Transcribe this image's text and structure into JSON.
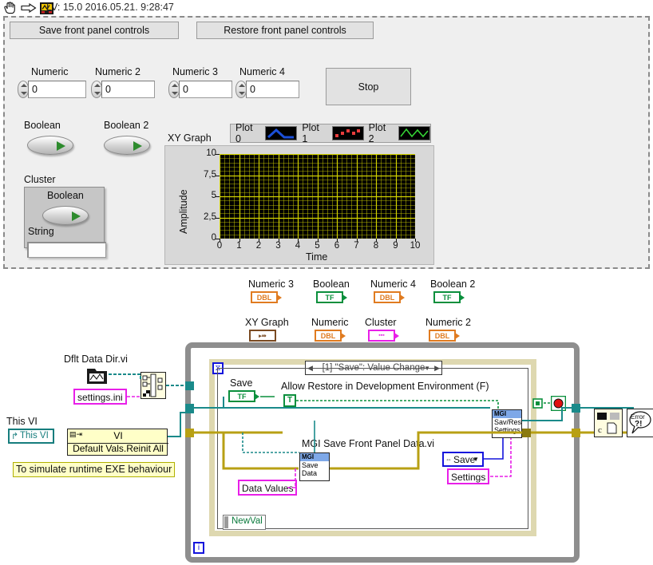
{
  "titlebar": {
    "text": "LV: 15.0 2016.05.21. 9:28:47",
    "icons": [
      "hand-cursor-icon",
      "run-arrow-icon",
      "labview-vi-icon"
    ]
  },
  "front_panel": {
    "buttons": [
      {
        "name": "save-front-panel-controls-button",
        "label": "Save front panel controls"
      },
      {
        "name": "restore-front-panel-controls-button",
        "label": "Restore front panel controls"
      },
      {
        "name": "stop-button",
        "label": "Stop"
      }
    ],
    "numerics": [
      {
        "label": "Numeric",
        "value": "0"
      },
      {
        "label": "Numeric 2",
        "value": "0"
      },
      {
        "label": "Numeric 3",
        "value": "0"
      },
      {
        "label": "Numeric 4",
        "value": "0"
      }
    ],
    "booleans": [
      {
        "label": "Boolean"
      },
      {
        "label": "Boolean 2"
      }
    ],
    "cluster": {
      "label": "Cluster",
      "boolean_label": "Boolean",
      "string_label": "String",
      "string_value": ""
    },
    "graph": {
      "label": "XY Graph",
      "plots": [
        {
          "name": "Plot 0",
          "style": "line",
          "color": "#1414c8"
        },
        {
          "name": "Plot 1",
          "style": "scatter",
          "color": "#e02828"
        },
        {
          "name": "Plot 2",
          "style": "line",
          "color": "#2fc82f"
        }
      ]
    }
  },
  "chart_data": {
    "type": "line",
    "title": "XY Graph",
    "xlabel": "Time",
    "ylabel": "Amplitude",
    "xlim": [
      0,
      10
    ],
    "ylim": [
      0,
      10
    ],
    "xticks": [
      "0",
      "1",
      "2",
      "3",
      "4",
      "5",
      "6",
      "7",
      "8",
      "9",
      "10"
    ],
    "yticks": [
      "0",
      "2,5",
      "5",
      "7,5",
      "10"
    ],
    "grid": true,
    "grid_color": "#d2d200",
    "plot_bg": "#000000",
    "series": [
      {
        "name": "Plot 0",
        "color": "#1414c8",
        "x": [],
        "y": []
      },
      {
        "name": "Plot 1",
        "color": "#e02828",
        "x": [],
        "y": []
      },
      {
        "name": "Plot 2",
        "color": "#2fc82f",
        "x": [],
        "y": []
      }
    ]
  },
  "block_diagram": {
    "terminals_row1": [
      {
        "label": "Numeric 3",
        "type": "DBL"
      },
      {
        "label": "Boolean",
        "type": "TF"
      },
      {
        "label": "Numeric 4",
        "type": "DBL"
      },
      {
        "label": "Boolean 2",
        "type": "TF"
      }
    ],
    "terminals_row2": [
      {
        "label": "XY Graph",
        "type": "XY"
      },
      {
        "label": "Numeric",
        "type": "DBL"
      },
      {
        "label": "Cluster",
        "type": "CLU"
      },
      {
        "label": "Numeric 2",
        "type": "DBL"
      }
    ],
    "dflt_data_dir": {
      "label": "Dflt Data Dir.vi",
      "icon": "folder-icon"
    },
    "settings_ini": "settings.ini",
    "build_path_icon": "build-path-icon",
    "this_vi_label": "This VI",
    "this_vi_ref": "This VI",
    "invoke_node": {
      "class": "VI",
      "method": "Default Vals.Reinit All"
    },
    "comment": "To simulate runtime EXE behaviour",
    "event_case": "[1] \"Save\": Value Change",
    "save_terminal": "Save",
    "allow_restore_label": "Allow Restore in Development Environment (F)",
    "true_constant": "T",
    "mgi_save_fp_label": "MGI Save Front Panel Data.vi",
    "mgi_save_node": {
      "head": "MGI",
      "lines": [
        "Save",
        "Data"
      ]
    },
    "data_values": "Data Values",
    "save_enum": "Save",
    "settings_const": "Settings",
    "mgi_savres_node": {
      "head": "MGI",
      "lines": [
        "Sav/Res",
        "Settings"
      ]
    },
    "stop_indicator": "stop-indicator-icon",
    "close_file_icon": "close-file-icon",
    "error_handler_icon": "error-handler-icon",
    "error_handler_label": "Error ?!",
    "newval": "NewVal",
    "iteration_terminal": "i"
  }
}
